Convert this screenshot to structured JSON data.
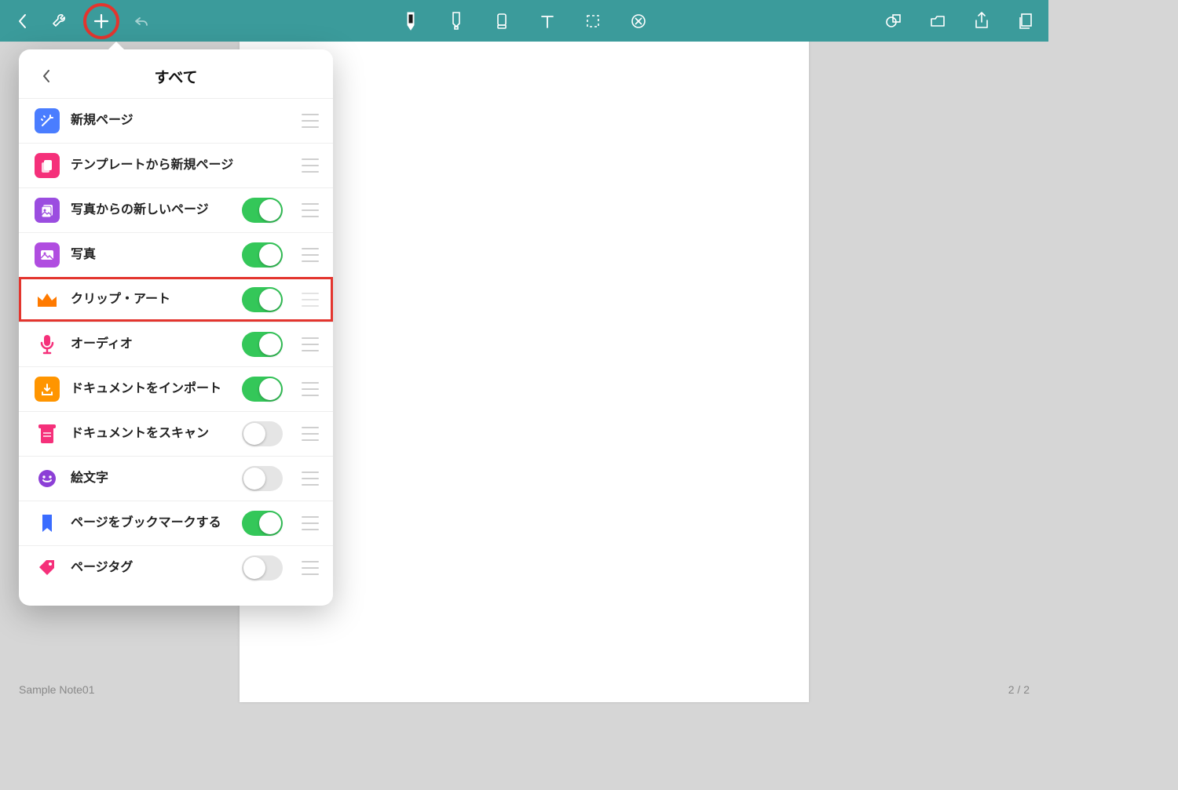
{
  "toolbar": {
    "back": "back",
    "wrench": "tools",
    "add": "add",
    "undo": "undo",
    "pen": "pen",
    "highlighter": "highlighter",
    "eraser": "eraser",
    "text": "text",
    "lasso": "lasso",
    "close_circle": "clear",
    "shape": "shape",
    "media": "media",
    "share": "share",
    "pages": "pages"
  },
  "popover": {
    "title": "すべて",
    "items": [
      {
        "label": "新規ページ",
        "toggle": null,
        "icon": "wand",
        "color": "bg-blue"
      },
      {
        "label": "テンプレートから新規ページ",
        "toggle": null,
        "icon": "template",
        "color": "bg-pink"
      },
      {
        "label": "写真からの新しいページ",
        "toggle": true,
        "icon": "photopage",
        "color": "bg-purple"
      },
      {
        "label": "写真",
        "toggle": true,
        "icon": "photo",
        "color": "bg-purple2"
      },
      {
        "label": "クリップ・アート",
        "toggle": true,
        "icon": "crown",
        "color": ""
      },
      {
        "label": "オーディオ",
        "toggle": true,
        "icon": "mic",
        "color": ""
      },
      {
        "label": "ドキュメントをインポート",
        "toggle": true,
        "icon": "import",
        "color": "bg-orange"
      },
      {
        "label": "ドキュメントをスキャン",
        "toggle": false,
        "icon": "scan",
        "color": ""
      },
      {
        "label": "絵文字",
        "toggle": false,
        "icon": "emoji",
        "color": "bg-violet"
      },
      {
        "label": "ページをブックマークする",
        "toggle": true,
        "icon": "bookmark",
        "color": ""
      },
      {
        "label": "ページタグ",
        "toggle": false,
        "icon": "tag",
        "color": ""
      }
    ],
    "highlight_index": 4
  },
  "footer": {
    "title": "Sample Note01",
    "page_indicator": "2 / 2"
  }
}
